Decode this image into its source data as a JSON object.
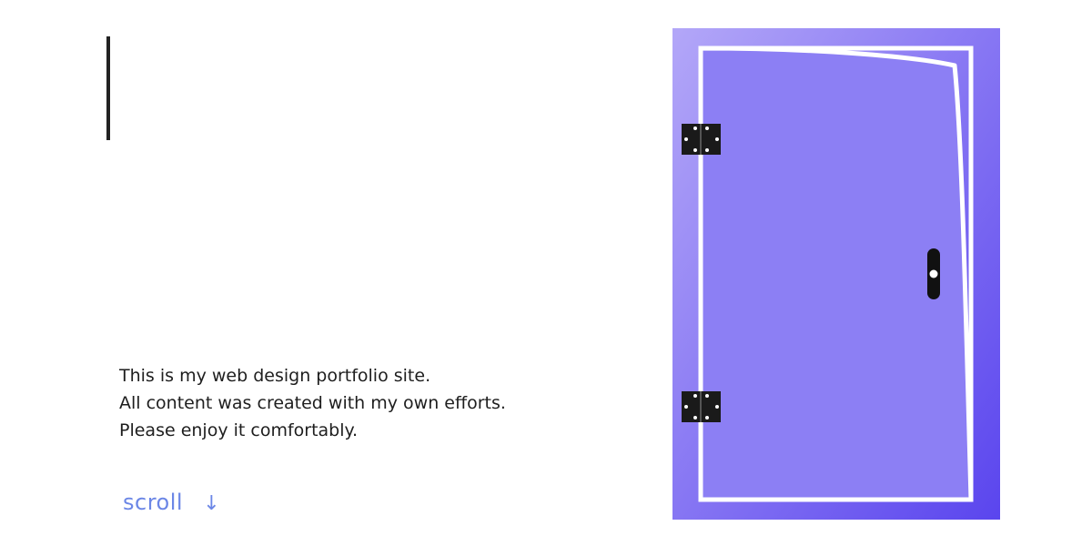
{
  "hero": {
    "intro_lines": [
      "This is my web design portfolio site.",
      "All content was created with my own efforts.",
      "Please enjoy it comfortably."
    ],
    "scroll_label": "scroll",
    "scroll_arrow": "↓"
  },
  "door": {
    "frame_gradient": [
      "#b3a7f8",
      "#5a45ee"
    ],
    "door_color": "#8c7ff4",
    "outline_color": "#ffffff",
    "hardware_color": "#1a1a1a"
  }
}
